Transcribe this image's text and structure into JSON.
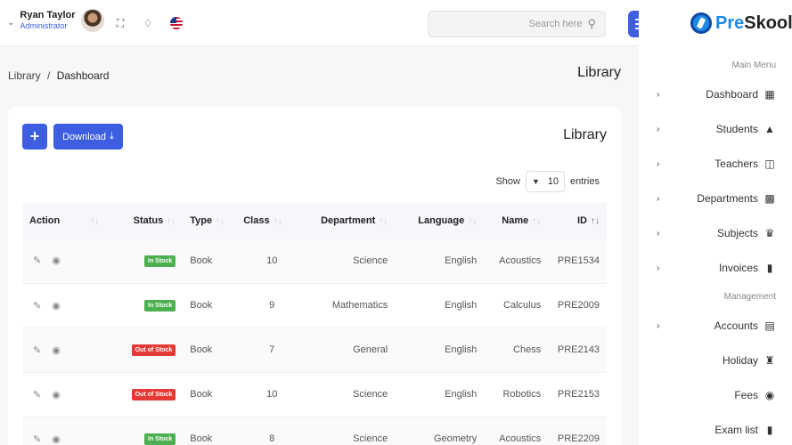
{
  "header": {
    "user_name": "Ryan Taylor",
    "user_role": "Administrator",
    "search_placeholder": "Search here"
  },
  "breadcrumb": {
    "parent": "Library",
    "separator": "/",
    "current": "Dashboard"
  },
  "page_title": "Library",
  "card": {
    "title": "Library",
    "add_label": "+",
    "download_label": "Download",
    "show_label": "Show",
    "entries_value": "10",
    "entries_label": "entries"
  },
  "table": {
    "columns": [
      "Action",
      "Status",
      "Type",
      "Class",
      "Department",
      "Language",
      "Name",
      "ID"
    ],
    "rows": [
      {
        "status": "In Stock",
        "status_type": "in",
        "type": "Book",
        "class": "10",
        "department": "Science",
        "language": "English",
        "name": "Acoustics",
        "id": "PRE1534"
      },
      {
        "status": "In Stock",
        "status_type": "in",
        "type": "Book",
        "class": "9",
        "department": "Mathematics",
        "language": "English",
        "name": "Calculus",
        "id": "PRE2009"
      },
      {
        "status": "Out of Stock",
        "status_type": "out",
        "type": "Book",
        "class": "7",
        "department": "General",
        "language": "English",
        "name": "Chess",
        "id": "PRE2143"
      },
      {
        "status": "Out of Stock",
        "status_type": "out",
        "type": "Book",
        "class": "10",
        "department": "Science",
        "language": "English",
        "name": "Robotics",
        "id": "PRE2153"
      },
      {
        "status": "In Stock",
        "status_type": "in",
        "type": "Book",
        "class": "8",
        "department": "Science",
        "language": "Geometry",
        "name": "Acoustics",
        "id": "PRE2209"
      }
    ]
  },
  "sidebar": {
    "logo_pre": "Pre",
    "logo_post": "Skool",
    "main_menu_title": "Main Menu",
    "management_title": "Management",
    "items": [
      {
        "label": "Dashboard",
        "icon": "grid-icon"
      },
      {
        "label": "Students",
        "icon": "graduation-cap-icon"
      },
      {
        "label": "Teachers",
        "icon": "chalkboard-teacher-icon"
      },
      {
        "label": "Departments",
        "icon": "building-icon"
      },
      {
        "label": "Subjects",
        "icon": "book-reader-icon"
      },
      {
        "label": "Invoices",
        "icon": "clipboard-icon"
      },
      {
        "label": "Accounts",
        "icon": "file-invoice-icon"
      },
      {
        "label": "Holiday",
        "icon": "holiday-village-icon"
      },
      {
        "label": "Fees",
        "icon": "comment-dollar-icon"
      },
      {
        "label": "Exam list",
        "icon": "clipboard-list-icon"
      }
    ]
  },
  "colors": {
    "primary": "#3d5ee1",
    "in_stock": "#4caf50",
    "out_of_stock": "#e53935"
  }
}
